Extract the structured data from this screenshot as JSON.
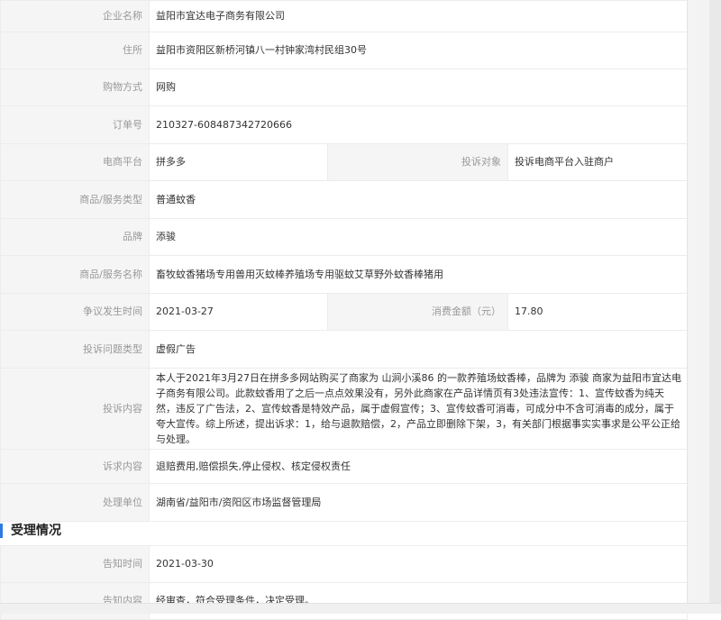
{
  "complaint": {
    "company_name": {
      "label": "企业名称",
      "value": "益阳市宜达电子商务有限公司"
    },
    "address": {
      "label": "住所",
      "value": "益阳市资阳区新桥河镇八一村钟家湾村民组30号"
    },
    "shopping_method": {
      "label": "购物方式",
      "value": "网购"
    },
    "order_number": {
      "label": "订单号",
      "value": "210327-608487342720666"
    },
    "platform": {
      "label": "电商平台",
      "value": "拼多多"
    },
    "complaint_target": {
      "label": "投诉对象",
      "value": "投诉电商平台入驻商户"
    },
    "product_type": {
      "label": "商品/服务类型",
      "value": "普通蚊香"
    },
    "brand": {
      "label": "品牌",
      "value": "添骏"
    },
    "product_name": {
      "label": "商品/服务名称",
      "value": "畜牧蚊香猪场专用兽用灭蚊棒养殖场专用驱蚊艾草野外蚊香棒猪用"
    },
    "dispute_date": {
      "label": "争议发生时间",
      "value": "2021-03-27"
    },
    "amount": {
      "label": "消费金额（元）",
      "value": "17.80"
    },
    "issue_type": {
      "label": "投诉问题类型",
      "value": "虚假广告"
    },
    "content": {
      "label": "投诉内容",
      "value": "本人于2021年3月27日在拼多多网站购买了商家为 山涧小溪86 的一款养殖场蚊香棒，品牌为 添骏 商家为益阳市宜达电子商务有限公司。此款蚊香用了之后一点点效果没有，另外此商家在产品详情页有3处违法宣传：1、宣传蚊香为纯天然，违反了广告法，2、宣传蚊香是特效产品，属于虚假宣传；3、宣传蚊香可消毒，可成分中不含可消毒的成分，属于夸大宣传。综上所述，提出诉求：1，给与退款赔偿，2，产品立即删除下架，3，有关部门根据事实实事求是公平公正给与处理。"
    },
    "demands": {
      "label": "诉求内容",
      "value": "退赔费用,赔偿损失,停止侵权、核定侵权责任"
    },
    "handler": {
      "label": "处理单位",
      "value": "湖南省/益阳市/资阳区市场监督管理局"
    }
  },
  "acceptance": {
    "title": "受理情况",
    "notice_time": {
      "label": "告知时间",
      "value": "2021-03-30"
    },
    "notice_content": {
      "label": "告知内容",
      "value": "经审查，符合受理条件，决定受理。"
    }
  },
  "colors": {
    "label_bg": "#f5f5f5",
    "label_text": "#999999",
    "border": "#ececec",
    "accent": "#2c7be5"
  }
}
